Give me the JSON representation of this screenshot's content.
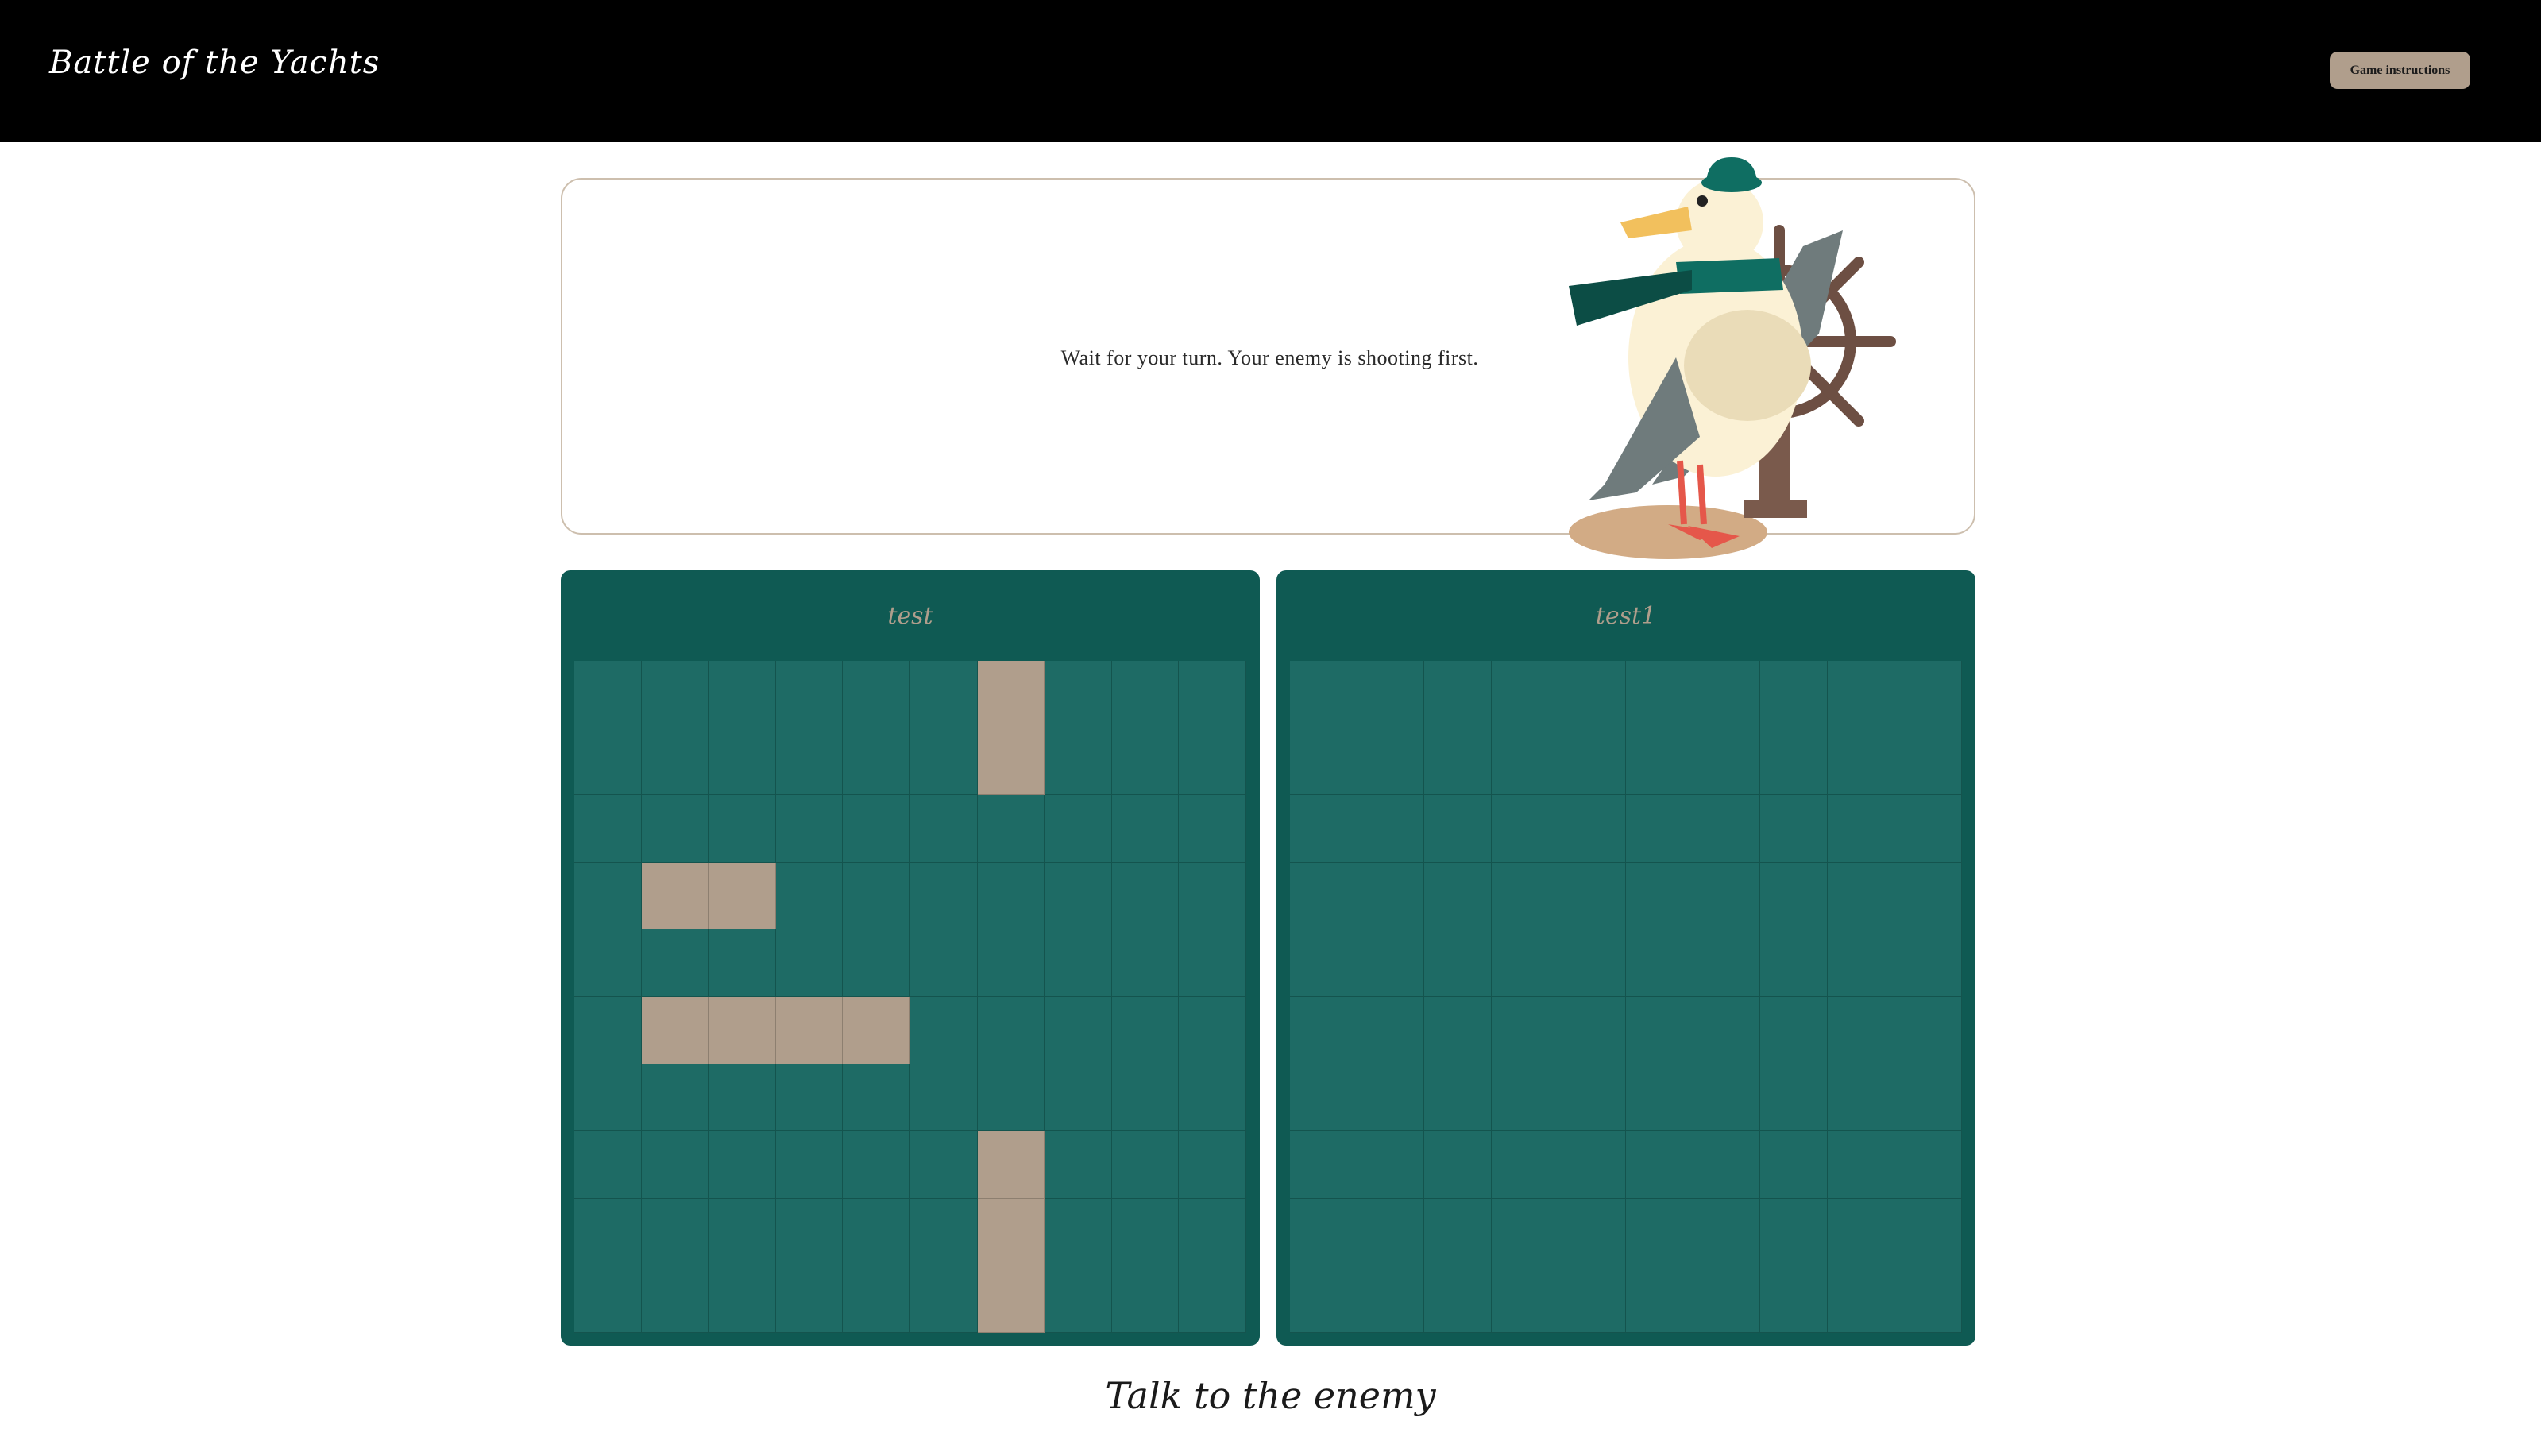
{
  "header": {
    "logo": "Battle of the Yachts",
    "instructions_button": "Game instructions"
  },
  "status": {
    "message": "Wait for your turn. Your enemy is shooting first."
  },
  "boards": [
    {
      "player": "test",
      "ships": [
        [
          6,
          0
        ],
        [
          6,
          1
        ],
        [
          1,
          3
        ],
        [
          2,
          3
        ],
        [
          1,
          5
        ],
        [
          2,
          5
        ],
        [
          3,
          5
        ],
        [
          4,
          5
        ],
        [
          6,
          7
        ],
        [
          6,
          8
        ],
        [
          6,
          9
        ]
      ]
    },
    {
      "player": "test1",
      "ships": []
    }
  ],
  "chat": {
    "heading": "Talk to the enemy"
  },
  "colors": {
    "board": "#0f5a53",
    "water": "#1e6b65",
    "ship": "#b09e8c",
    "accent": "#b09e8c"
  },
  "icons": {
    "mascot": "seagull-captain-illustration"
  }
}
